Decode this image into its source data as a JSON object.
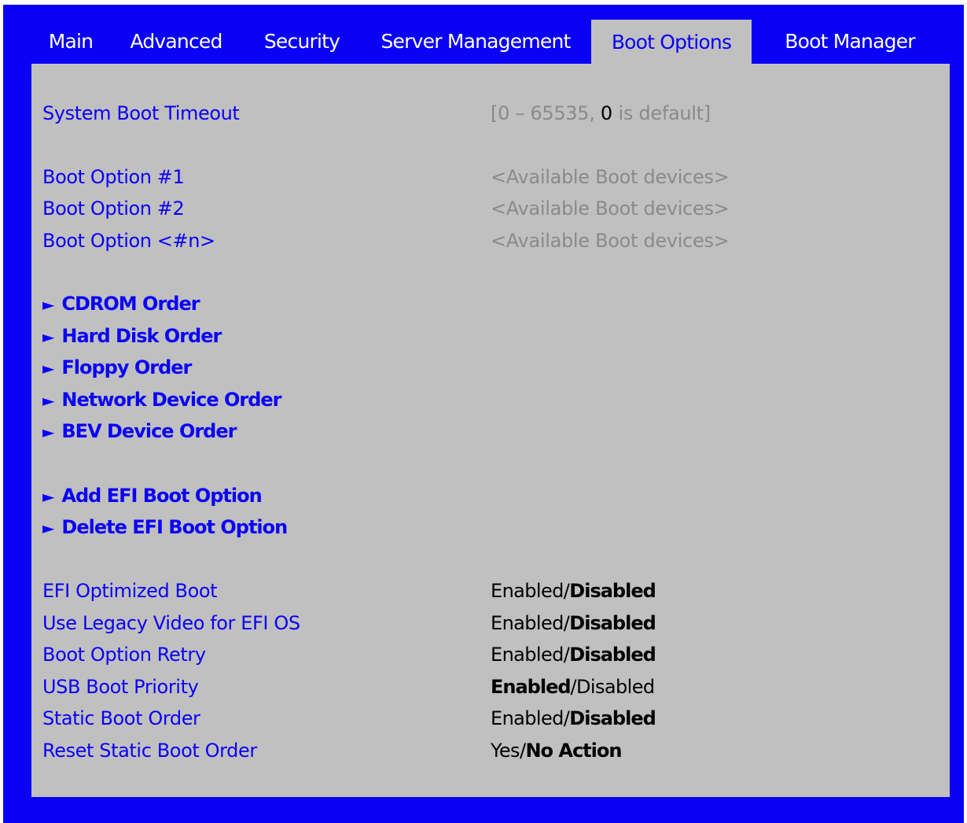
{
  "tabs": [
    {
      "label": "Main"
    },
    {
      "label": "Advanced"
    },
    {
      "label": "Security"
    },
    {
      "label": "Server Management"
    },
    {
      "label": "Boot Options",
      "active": true
    },
    {
      "label": "Boot Manager"
    }
  ],
  "settings": {
    "system_boot_timeout": {
      "label": "System Boot Timeout",
      "value_prefix": "[0 – 65535, ",
      "value_default": "0",
      "value_suffix": " is default]"
    },
    "boot_option_1": {
      "label": "Boot Option #1",
      "value": "<Available Boot devices>"
    },
    "boot_option_2": {
      "label": "Boot Option #2",
      "value": "<Available Boot devices>"
    },
    "boot_option_n": {
      "label": "Boot Option <#n>",
      "value": "<Available Boot devices>"
    }
  },
  "submenus": {
    "arrow_icon": "triangle-right-icon",
    "cdrom_order": "CDROM Order",
    "hard_disk_order": "Hard Disk Order",
    "floppy_order": "Floppy Order",
    "network_device_order": "Network Device Order",
    "bev_device_order": "BEV Device Order",
    "add_efi_boot_option": "Add EFI Boot Option",
    "delete_efi_boot_option": "Delete EFI Boot Option"
  },
  "options": {
    "separator": "/",
    "efi_optimized_boot": {
      "label": "EFI Optimized Boot",
      "choice_a": "Enabled",
      "choice_b": "Disabled",
      "default": "Disabled"
    },
    "legacy_video_efi_os": {
      "label": "Use Legacy Video for EFI OS",
      "choice_a": "Enabled",
      "choice_b": "Disabled",
      "default": "Disabled"
    },
    "boot_option_retry": {
      "label": "Boot Option Retry",
      "choice_a": "Enabled",
      "choice_b": "Disabled",
      "default": "Disabled"
    },
    "usb_boot_priority": {
      "label": "USB Boot Priority",
      "choice_a": "Enabled",
      "choice_b": "Disabled",
      "default": "Enabled"
    },
    "static_boot_order": {
      "label": "Static Boot Order",
      "choice_a": "Enabled",
      "choice_b": "Disabled",
      "default": "Disabled"
    },
    "reset_static_boot_order": {
      "label": "Reset Static Boot Order",
      "choice_a": "Yes",
      "choice_b": "No Action",
      "default": "No Action"
    }
  },
  "colors": {
    "frame_blue": "#0a00f5",
    "panel_gray": "#c0c0c0",
    "label_blue": "#0a00f5",
    "hint_gray": "#8a8a8a",
    "value_black": "#000000"
  }
}
